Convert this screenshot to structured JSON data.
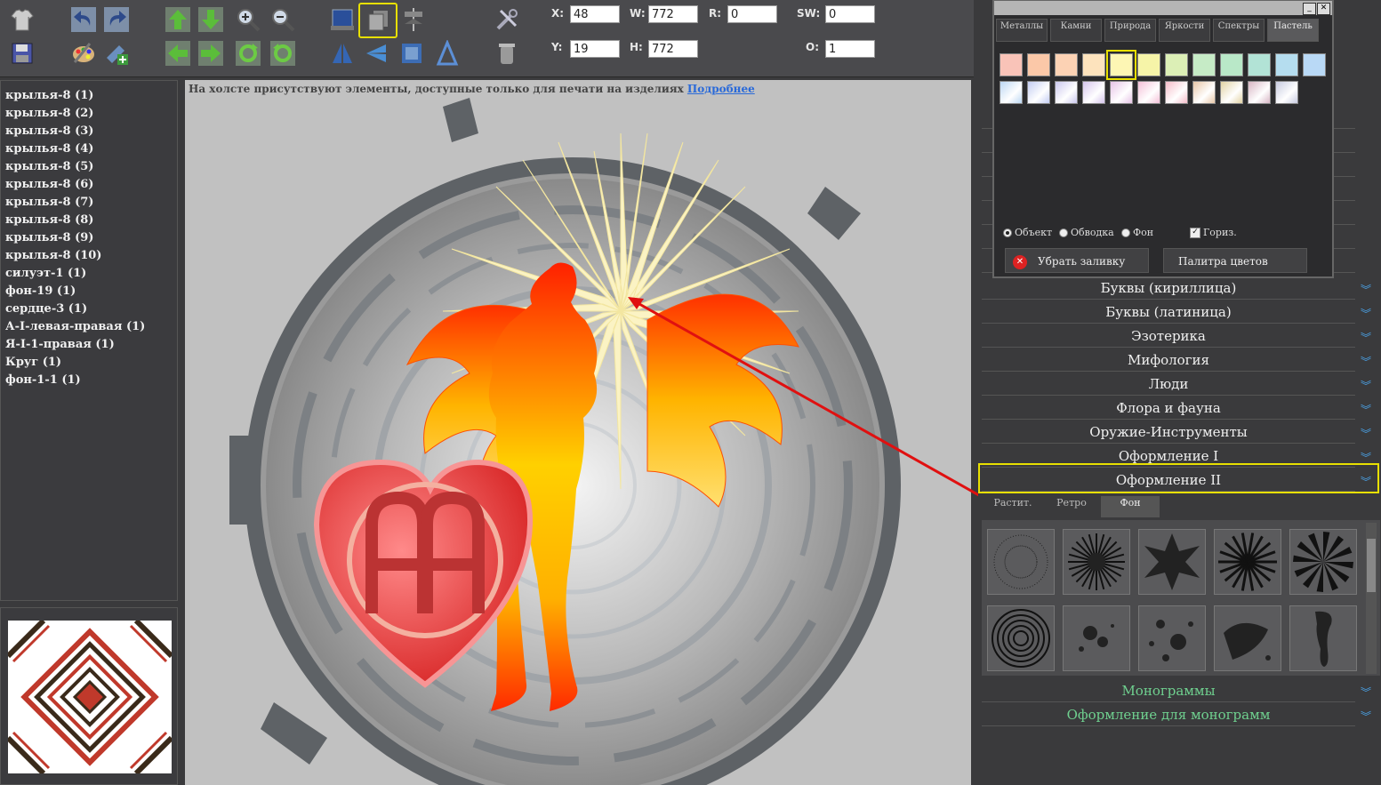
{
  "fields": {
    "x": {
      "label": "X:",
      "value": "48"
    },
    "y": {
      "label": "Y:",
      "value": "19"
    },
    "w": {
      "label": "W:",
      "value": "772"
    },
    "h": {
      "label": "H:",
      "value": "772"
    },
    "r": {
      "label": "R:",
      "value": "0"
    },
    "sw": {
      "label": "SW:",
      "value": "0"
    },
    "o": {
      "label": "O:",
      "value": "1"
    }
  },
  "layers": [
    "крылья-8 (1)",
    "крылья-8 (2)",
    "крылья-8 (3)",
    "крылья-8 (4)",
    "крылья-8 (5)",
    "крылья-8 (6)",
    "крылья-8 (7)",
    "крылья-8 (8)",
    "крылья-8 (9)",
    "крылья-8 (10)",
    "силуэт-1 (1)",
    "фон-19 (1)",
    "сердце-3 (1)",
    "А-I-левая-правая (1)",
    "Я-I-1-правая (1)",
    "Круг (1)",
    "фон-1-1 (1)"
  ],
  "notice": {
    "text": "На холсте присутствуют элементы, доступные только для печати на изделиях",
    "link": "Подробнее"
  },
  "color_window": {
    "tabs": [
      "Металлы",
      "Камни",
      "Природа",
      "Яркости",
      "Спектры",
      "Пастель"
    ],
    "active_tab": "Пастель",
    "swatches_row1": [
      "#f9c3b8",
      "#fbc8a8",
      "#fcd2b4",
      "#fde3bd",
      "#fdf6b4",
      "#f6f4a8",
      "#dcefb6",
      "#c6ebc6",
      "#b9e8c8",
      "#b2e3d6",
      "#b5ddef",
      "#b9d9f6"
    ],
    "swatches_row2": [
      "#bcd7f3",
      "#c3cdf2",
      "#cbc8ee",
      "#d6c5ec",
      "#e6c5e6",
      "#f4c0d8",
      "#f5bdca",
      "#e8c7a8",
      "#e2d3a4",
      "#d8b6c4",
      "#c8cbe0"
    ],
    "radios": [
      {
        "label": "Объект",
        "checked": true
      },
      {
        "label": "Обводка",
        "checked": false
      },
      {
        "label": "Фон",
        "checked": false
      }
    ],
    "checkbox": {
      "label": "Гориз.",
      "checked": true
    },
    "remove_fill": "Убрать заливку",
    "palette": "Палитра цветов"
  },
  "categories": [
    {
      "label": "Буквы (кириллица)",
      "green": false
    },
    {
      "label": "Буквы (латиница)",
      "green": false
    },
    {
      "label": "Эзотерика",
      "green": false
    },
    {
      "label": "Мифология",
      "green": false
    },
    {
      "label": "Люди",
      "green": false
    },
    {
      "label": "Флора и фауна",
      "green": false
    },
    {
      "label": "Оружие-Инструменты",
      "green": false
    },
    {
      "label": "Оформление I",
      "green": false
    },
    {
      "label": "Оформление II",
      "green": false
    },
    {
      "label": "Монограммы",
      "green": true
    },
    {
      "label": "Оформление для монограмм",
      "green": true
    }
  ],
  "subtabs": [
    "Растит.",
    "Ретро",
    "Фон"
  ],
  "active_subtab": "Фон",
  "icons": [
    "shirt-icon",
    "save-icon",
    "undo-icon",
    "redo-icon",
    "palette-icon",
    "add-image-icon",
    "move-up-icon",
    "move-down-icon",
    "move-left-icon",
    "move-right-icon",
    "zoom-in-icon",
    "zoom-out-icon",
    "rotate-cw-icon",
    "rotate-ccw-icon",
    "bring-front-icon",
    "send-back-icon",
    "align-icon",
    "flip-v-icon",
    "flip-h-icon",
    "tools-icon",
    "trash-icon"
  ]
}
